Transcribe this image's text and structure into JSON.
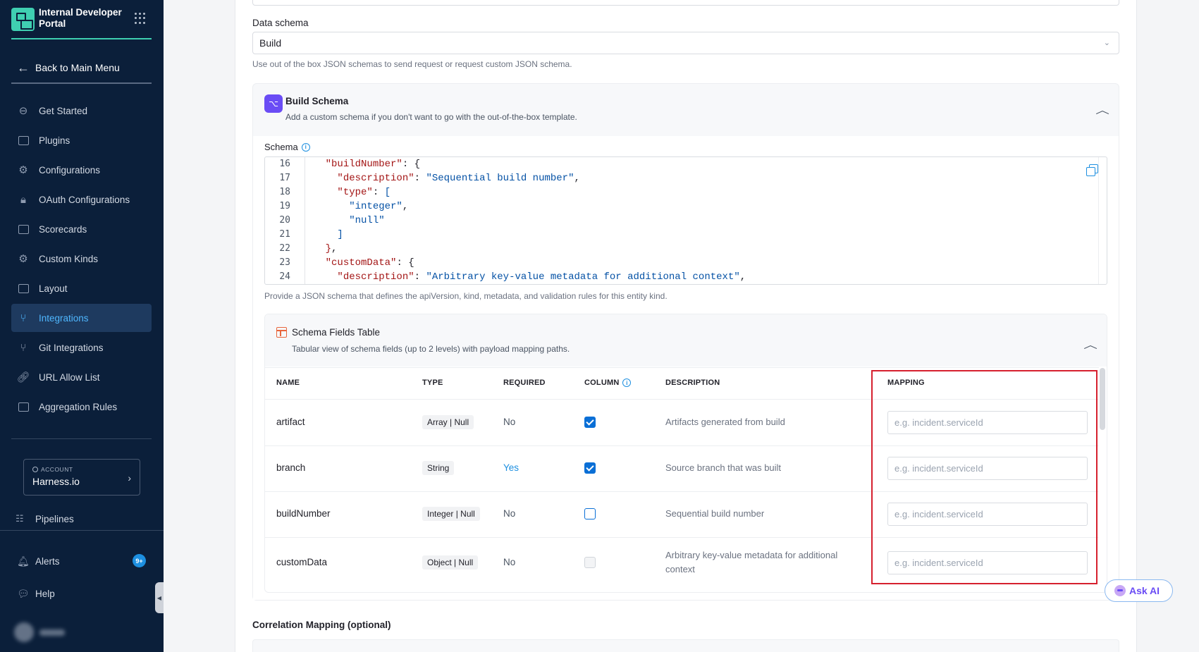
{
  "sidebar": {
    "brand": "Internal Developer Portal",
    "back_label": "Back to Main Menu",
    "items": [
      {
        "label": "Get Started",
        "icon": "rocket-icon"
      },
      {
        "label": "Plugins",
        "icon": "plug-icon"
      },
      {
        "label": "Configurations",
        "icon": "sliders-icon"
      },
      {
        "label": "OAuth Configurations",
        "icon": "lock-icon"
      },
      {
        "label": "Scorecards",
        "icon": "scorecard-icon"
      },
      {
        "label": "Custom Kinds",
        "icon": "gear-icon"
      },
      {
        "label": "Layout",
        "icon": "layout-icon"
      },
      {
        "label": "Integrations",
        "icon": "integrations-icon",
        "active": true
      },
      {
        "label": "Git Integrations",
        "icon": "git-icon"
      },
      {
        "label": "URL Allow List",
        "icon": "link-icon"
      },
      {
        "label": "Aggregation Rules",
        "icon": "rules-icon"
      }
    ],
    "account_label": "ACCOUNT",
    "account_value": "Harness.io",
    "pipelines_label": "Pipelines",
    "alerts_label": "Alerts",
    "alerts_badge": "9+",
    "help_label": "Help"
  },
  "form": {
    "data_schema_label": "Data schema",
    "data_schema_value": "Build",
    "data_schema_help": "Use out of the box JSON schemas to send request or request custom JSON schema.",
    "build_schema_title": "Build Schema",
    "build_schema_sub": "Add a custom schema if you don't want to go with the out-of-the-box template.",
    "schema_label": "Schema",
    "schema_help": "Provide a JSON schema that defines the apiVersion, kind, metadata, and validation rules for this entity kind.",
    "editor_lines": [
      {
        "n": "16",
        "html": "<span class=\"k\">\"buildNumber\"</span><span class=\"p\">: {</span>",
        "indent": 2
      },
      {
        "n": "17",
        "html": "<span class=\"k\">\"description\"</span><span class=\"p\">: </span><span class=\"s\">\"Sequential build number\"</span><span class=\"p\">,</span>",
        "indent": 3
      },
      {
        "n": "18",
        "html": "<span class=\"k\">\"type\"</span><span class=\"p\">: </span><span class=\"s\">[</span>",
        "indent": 3
      },
      {
        "n": "19",
        "html": "<span class=\"s\">\"integer\"</span><span class=\"p\">,</span>",
        "indent": 4
      },
      {
        "n": "20",
        "html": "<span class=\"s\">\"null\"</span>",
        "indent": 4
      },
      {
        "n": "21",
        "html": "<span class=\"s\">]</span>",
        "indent": 3
      },
      {
        "n": "22",
        "html": "<span class=\"k\">}</span><span class=\"p\">,</span>",
        "indent": 2
      },
      {
        "n": "23",
        "html": "<span class=\"k\">\"customData\"</span><span class=\"p\">: {</span>",
        "indent": 2
      },
      {
        "n": "24",
        "html": "<span class=\"k\">\"description\"</span><span class=\"p\">: </span><span class=\"s\">\"Arbitrary key-value metadata for additional context\"</span><span class=\"p\">,</span>",
        "indent": 3
      }
    ],
    "fields_table_title": "Schema Fields Table",
    "fields_table_sub": "Tabular view of schema fields (up to 2 levels) with payload mapping paths.",
    "columns": {
      "name": "NAME",
      "type": "TYPE",
      "required": "REQUIRED",
      "column": "COLUMN",
      "description": "DESCRIPTION",
      "mapping": "MAPPING"
    },
    "rows": [
      {
        "name": "artifact",
        "type_a": "Array",
        "type_b": "Null",
        "required": "No",
        "column": "on",
        "description": "Artifacts generated from build",
        "mapping_placeholder": "e.g. incident.serviceId"
      },
      {
        "name": "branch",
        "type_a": "String",
        "type_b": "",
        "required": "Yes",
        "column": "on",
        "description": "Source branch that was built",
        "mapping_placeholder": "e.g. incident.serviceId"
      },
      {
        "name": "buildNumber",
        "type_a": "Integer",
        "type_b": "Null",
        "required": "No",
        "column": "off",
        "description": "Sequential build number",
        "mapping_placeholder": "e.g. incident.serviceId"
      },
      {
        "name": "customData",
        "type_a": "Object",
        "type_b": "Null",
        "required": "No",
        "column": "disabled",
        "description": "Arbitrary key-value metadata for additional context",
        "mapping_placeholder": "e.g. incident.serviceId"
      }
    ],
    "correlation_label": "Correlation Mapping (optional)"
  },
  "ask_ai_label": "Ask AI",
  "colors": {
    "sidebar_bg": "#0b1f3a",
    "accent": "#3fcfb1",
    "active": "#4fb7ff",
    "link": "#1d8fe0",
    "highlight": "#d6202e"
  }
}
